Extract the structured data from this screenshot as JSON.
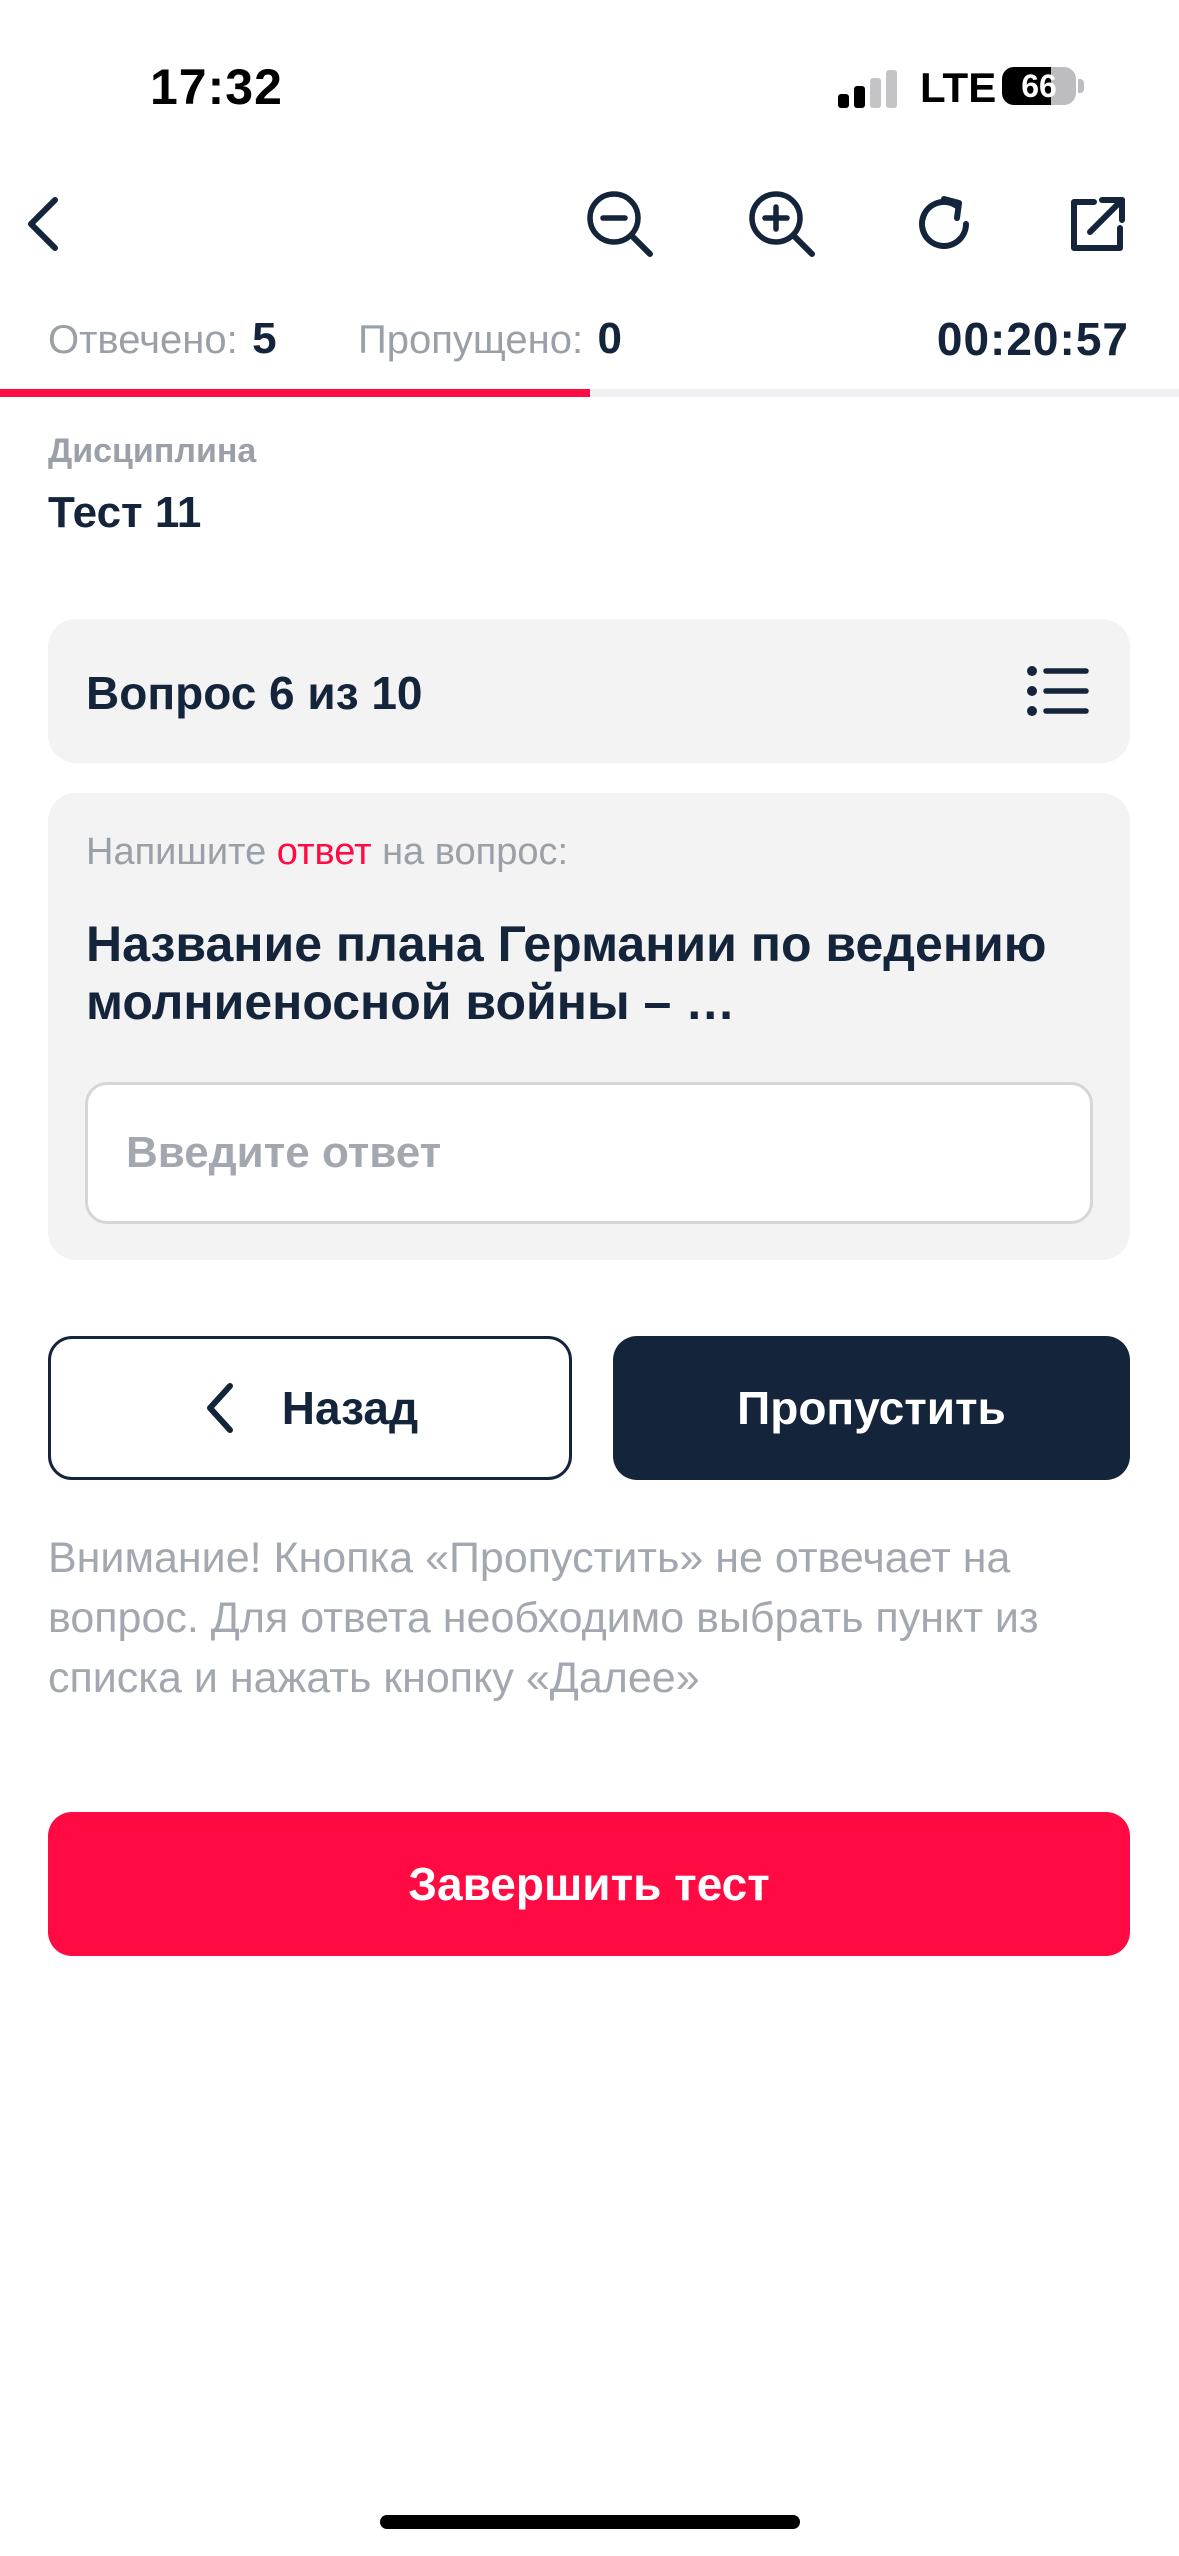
{
  "status_bar": {
    "time": "17:32",
    "network": "LTE",
    "battery": "66",
    "battery_level": 0.66,
    "signal_bars_active": 2,
    "signal_bars_total": 4
  },
  "toolbar": {
    "icons": [
      "back-arrow-icon",
      "zoom-out-icon",
      "zoom-in-icon",
      "refresh-icon",
      "open-external-icon"
    ]
  },
  "progress": {
    "answered_label": "Отвечено:",
    "answered_value": "5",
    "skipped_label": "Пропущено:",
    "skipped_value": "0",
    "timer": "00:20:57",
    "progress_fraction": 0.5,
    "accent_color": "#ff0a42"
  },
  "discipline": {
    "label": "Дисциплина",
    "value": "Тест 11"
  },
  "question_header": {
    "title": "Вопрос 6 из 10",
    "icon": "question-list-icon"
  },
  "question": {
    "instruction_before": "Напишите ",
    "instruction_accent": "ответ",
    "instruction_after": " на вопрос:",
    "text": "Название плана Германии по ведению молниеносной войны – …",
    "answer_placeholder": "Введите ответ",
    "answer_value": ""
  },
  "buttons": {
    "back_label": "Назад",
    "skip_label": "Пропустить",
    "finish_label": "Завершить тест"
  },
  "warning_text": "Внимание! Кнопка «Пропустить» не отвечает на вопрос. Для ответа необходимо выбрать пункт из списка и нажать кнопку «Далее»",
  "colors": {
    "primary_dark": "#14243a",
    "accent": "#ff0a42",
    "card_bg": "#f3f3f4",
    "muted_text": "#9aa0a8"
  }
}
